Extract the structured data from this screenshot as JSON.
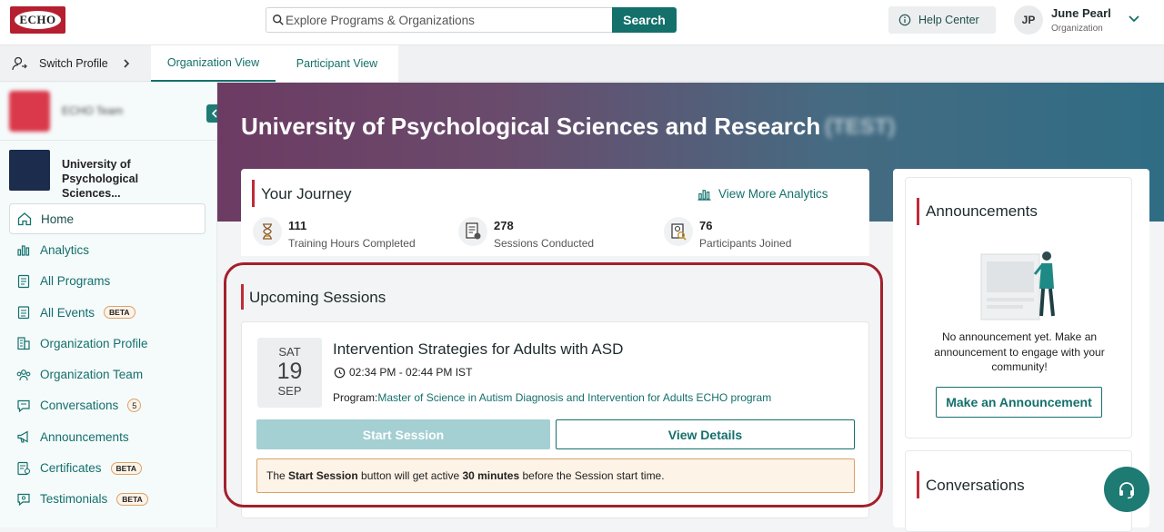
{
  "header": {
    "logo_text": "ECHO",
    "search": {
      "placeholder": "Explore Programs & Organizations",
      "button_label": "Search"
    },
    "help_label": "Help Center",
    "user": {
      "initials": "JP",
      "name": "June Pearl",
      "role": "Organization"
    }
  },
  "subbar": {
    "switch_profile_label": "Switch Profile",
    "tabs": [
      {
        "label": "Organization View",
        "active": true
      },
      {
        "label": "Participant View",
        "active": false
      }
    ]
  },
  "sidebar": {
    "team_name": "ECHO Team",
    "org_name": "University of Psychological Sciences...",
    "items": [
      {
        "label": "Home",
        "icon": "home-icon",
        "active": true
      },
      {
        "label": "Analytics",
        "icon": "analytics-icon"
      },
      {
        "label": "All Programs",
        "icon": "programs-icon"
      },
      {
        "label": "All Events",
        "icon": "events-icon",
        "badge": "BETA"
      },
      {
        "label": "Organization Profile",
        "icon": "building-icon"
      },
      {
        "label": "Organization Team",
        "icon": "team-icon"
      },
      {
        "label": "Conversations",
        "icon": "chat-icon",
        "count": "5"
      },
      {
        "label": "Announcements",
        "icon": "megaphone-icon"
      },
      {
        "label": "Certificates",
        "icon": "certificate-icon",
        "badge": "BETA"
      },
      {
        "label": "Testimonials",
        "icon": "testimonial-icon",
        "badge": "BETA"
      }
    ]
  },
  "hero": {
    "title": "University of Psychological Sciences and Research",
    "tag": "(TEST)"
  },
  "journey": {
    "title": "Your Journey",
    "analytics_link": "View More Analytics",
    "stats": [
      {
        "value": "111",
        "label": "Training Hours Completed",
        "icon": "hourglass-icon"
      },
      {
        "value": "278",
        "label": "Sessions Conducted",
        "icon": "document-icon"
      },
      {
        "value": "76",
        "label": "Participants Joined",
        "icon": "participant-icon"
      }
    ]
  },
  "upcoming": {
    "title": "Upcoming Sessions",
    "session": {
      "dow": "SAT",
      "day": "19",
      "month": "SEP",
      "title": "Intervention Strategies for Adults with ASD",
      "time": "02:34 PM - 02:44 PM IST",
      "program_label": "Program:",
      "program_name": "Master of Science in Autism Diagnosis and Intervention for Adults ECHO program",
      "start_label": "Start Session",
      "details_label": "View Details",
      "note": {
        "p1": "The ",
        "b1": "Start Session",
        "p2": " button will get active ",
        "b2": "30 minutes",
        "p3": " before the Session start time."
      }
    }
  },
  "announcements": {
    "title": "Announcements",
    "empty_text": "No announcement yet. Make an announcement to engage with your community!",
    "button_label": "Make an Announcement"
  },
  "conversations": {
    "title": "Conversations"
  },
  "colors": {
    "primary": "#13706b",
    "accent": "#c02a39",
    "highlight": "#a3202c"
  }
}
